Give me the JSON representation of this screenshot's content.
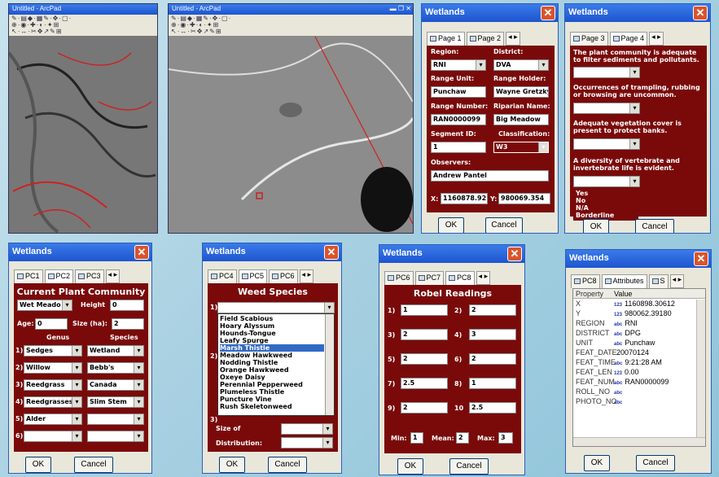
{
  "maps": {
    "map1_title": "Untitled - ArcPad",
    "map2_title": "Untitled - ArcPad",
    "toolbar_row1": "✎·▤◆·▦✎·✥·▢·",
    "toolbar_row2": "⊕·◉·✚·◐·✦⊞",
    "toolbar_row3": "↖·↔·✂✥↗✎⊞"
  },
  "win1": {
    "title": "Wetlands",
    "tabs": [
      "Page 1",
      "Page 2"
    ],
    "labels": {
      "region": "Region:",
      "district": "District:",
      "range_unit": "Range Unit:",
      "range_holder": "Range Holder:",
      "range_number": "Range Number:",
      "riparian_name": "Riparian Name:",
      "segment_id": "Segment ID:",
      "classification": "Classification:",
      "observers": "Observers:",
      "x": "X:",
      "y": "Y:"
    },
    "values": {
      "region": "RNI",
      "district": "DVA",
      "range_unit": "Punchaw",
      "range_holder": "Wayne Gretzky",
      "range_number": "RAN0000099",
      "riparian_name": "Big Meadow",
      "segment_id": "1",
      "classification": "W3",
      "observers": "Andrew Pantel",
      "x": "1160878.92",
      "y": "980069.354"
    },
    "ok": "OK",
    "cancel": "Cancel"
  },
  "win2": {
    "title": "Wetlands",
    "tabs": [
      "Page 3",
      "Page 4"
    ],
    "q1": "The plant community is adequate to filter sediments and pollutants.",
    "q2": "Occurrences of trampling, rubbing or browsing are uncommon.",
    "q3": "Adequate vegetation cover is present to protect banks.",
    "q4": "A diversity of vertebrate and invertebrate life is evident.",
    "options": [
      "Yes",
      "No",
      "N/A",
      "Borderline"
    ],
    "ok": "OK",
    "cancel": "Cancel"
  },
  "win3": {
    "title": "Wetlands",
    "tabs": [
      "PC1",
      "PC2",
      "PC3"
    ],
    "heading": "Current Plant Community",
    "community": "Wet Meado",
    "height_label": "Height",
    "height": "0",
    "age_label": "Age:",
    "age": "0",
    "size_label": "Size (ha):",
    "size": "2",
    "genus_h": "Genus",
    "species_h": "Species",
    "rows": [
      {
        "n": "1)",
        "genus": "Sedges",
        "species": "Wetland"
      },
      {
        "n": "2)",
        "genus": "Willow",
        "species": "Bebb's"
      },
      {
        "n": "3)",
        "genus": "Reedgrass",
        "species": "Canada"
      },
      {
        "n": "4)",
        "genus": "Reedgrasses",
        "species": "Slim Stem"
      },
      {
        "n": "5)",
        "genus": "Alder",
        "species": ""
      },
      {
        "n": "6)",
        "genus": "",
        "species": ""
      }
    ],
    "ok": "OK",
    "cancel": "Cancel"
  },
  "win4": {
    "title": "Wetlands",
    "tabs": [
      "PC4",
      "PC5",
      "PC6"
    ],
    "heading": "Weed Species",
    "n1": "1)",
    "n2": "2)",
    "n3": "3)",
    "weeds": [
      "Field Scabious",
      "Hoary Alyssum",
      "Hounds-Tongue",
      "Leafy Spurge",
      "Marsh Thistle",
      "Meadow Hawkweed",
      "Nodding Thistle",
      "Orange Hawkweed",
      "Oxeye Daisy",
      "Perennial Pepperweed",
      "Plumeless Thistle",
      "Puncture Vine",
      "Rush Skeletonweed"
    ],
    "selected": "Marsh Thistle",
    "size_label": "Size of",
    "dist_label": "Distribution:",
    "ok": "OK",
    "cancel": "Cancel"
  },
  "win5": {
    "title": "Wetlands",
    "tabs": [
      "PC6",
      "PC7",
      "PC8"
    ],
    "heading": "Robel Readings",
    "left": [
      {
        "n": "1)",
        "v": "1"
      },
      {
        "n": "3)",
        "v": "2"
      },
      {
        "n": "5)",
        "v": "2"
      },
      {
        "n": "7)",
        "v": "2.5"
      },
      {
        "n": "9)",
        "v": "2"
      }
    ],
    "right": [
      {
        "n": "2)",
        "v": "2"
      },
      {
        "n": "4)",
        "v": "3"
      },
      {
        "n": "6)",
        "v": "2"
      },
      {
        "n": "8)",
        "v": "1"
      },
      {
        "n": "10",
        "v": "2.5"
      }
    ],
    "min_label": "Min:",
    "min": "1",
    "mean_label": "Mean:",
    "mean": "2",
    "max_label": "Max:",
    "max": "3",
    "ok": "OK",
    "cancel": "Cancel"
  },
  "win6": {
    "title": "Wetlands",
    "tabs": [
      "PC8",
      "Attributes",
      "S"
    ],
    "col_property": "Property",
    "col_value": "Value",
    "rows": [
      {
        "p": "X",
        "t": "123",
        "v": "1160898.30612"
      },
      {
        "p": "Y",
        "t": "123",
        "v": "980062.39180"
      },
      {
        "p": "REGION",
        "t": "abc",
        "v": "RNI"
      },
      {
        "p": "DISTRICT",
        "t": "abc",
        "v": "DPG"
      },
      {
        "p": "UNIT",
        "t": "abc",
        "v": "Punchaw"
      },
      {
        "p": "FEAT_DATE",
        "t": "",
        "v": "20070124"
      },
      {
        "p": "FEAT_TIME",
        "t": "abc",
        "v": "9:21:28 AM"
      },
      {
        "p": "FEAT_LEN",
        "t": "123",
        "v": "0.00"
      },
      {
        "p": "FEAT_NUM",
        "t": "abc",
        "v": "RAN0000099"
      },
      {
        "p": "ROLL_NO",
        "t": "abc",
        "v": ""
      },
      {
        "p": "PHOTO_NO",
        "t": "abc",
        "v": ""
      }
    ],
    "ok": "OK",
    "cancel": "Cancel"
  }
}
